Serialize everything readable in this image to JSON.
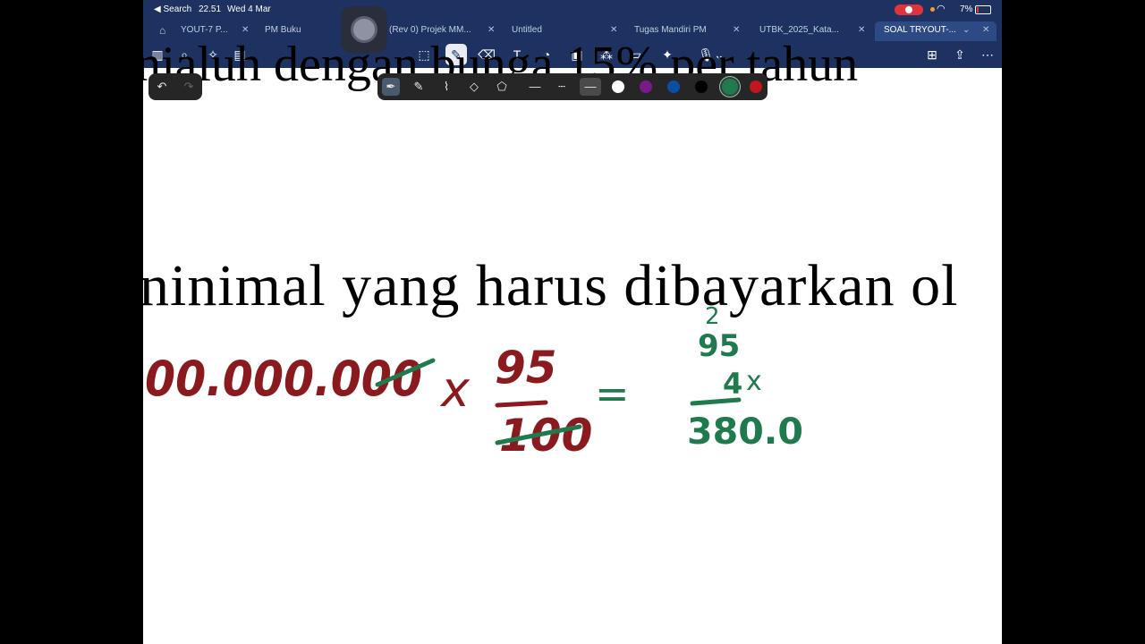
{
  "status": {
    "back_label": "◀ Search",
    "time": "22.51",
    "date": "Wed 4 Mar",
    "battery": "7%"
  },
  "tabs": [
    {
      "label": "YOUT-7 P...",
      "active": false
    },
    {
      "label": "PM Buku",
      "active": false
    },
    {
      "label": "(Rev 0) Projek MM...",
      "active": false
    },
    {
      "label": "Untitled",
      "active": false
    },
    {
      "label": "Tugas Mandiri PM",
      "active": false
    },
    {
      "label": "UTBK_2025_Kata...",
      "active": false
    },
    {
      "label": "SOAL TRYOUT-...",
      "active": true
    }
  ],
  "document": {
    "line_top": "njaluh dengan bunga 15% per tahun",
    "line_main": "ninimal yang harus dibayarkan ol"
  },
  "ink": {
    "red_amount": "00.000.000",
    "times": "x",
    "numerator": "95",
    "denominator": "100",
    "equals": "=",
    "green_top_small": "2",
    "green_top": "95",
    "green_mid": "4",
    "green_x": "x",
    "green_result": "380.0"
  },
  "colors": {
    "bar_bg": "#1d3260",
    "ink_red": "#8b1a1f",
    "ink_green": "#1f7a4e",
    "record_red": "#e0343a"
  }
}
